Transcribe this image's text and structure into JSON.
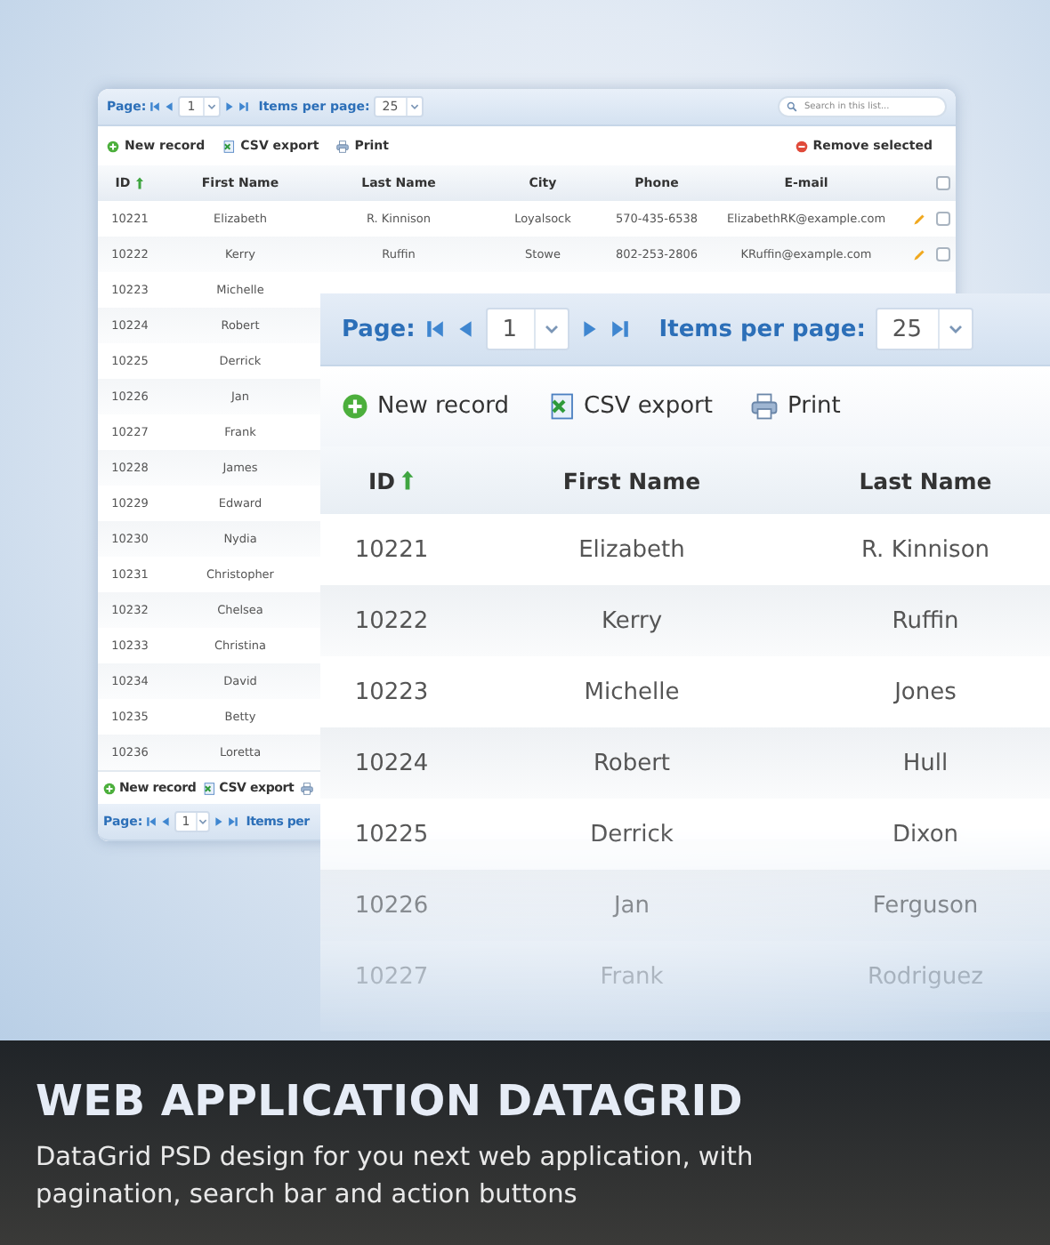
{
  "back_grid": {
    "pager": {
      "page_label": "Page:",
      "page": "1",
      "items_label": "Items per page:",
      "items_per_page": "25"
    },
    "search": {
      "placeholder": "Search in this list..."
    },
    "toolbar": [
      {
        "kind": "new",
        "label": "New record"
      },
      {
        "kind": "csv",
        "label": "CSV export"
      },
      {
        "kind": "print",
        "label": "Print"
      },
      {
        "kind": "remove",
        "label": "Remove selected"
      }
    ],
    "columns": [
      {
        "label": "ID",
        "sorted_ascending": true
      },
      {
        "label": "First Name",
        "sorted_ascending": false
      },
      {
        "label": "Last Name",
        "sorted_ascending": false
      },
      {
        "label": "City",
        "sorted_ascending": false
      },
      {
        "label": "Phone",
        "sorted_ascending": false
      },
      {
        "label": "E-mail",
        "sorted_ascending": false
      }
    ],
    "select_all": {
      "checked": false
    },
    "rows": [
      {
        "cells": [
          "10221",
          "Elizabeth",
          "R. Kinnison",
          "Loyalsock",
          "570-435-6538",
          "ElizabethRK@example.com"
        ],
        "checked": false
      },
      {
        "cells": [
          "10222",
          "Kerry",
          "Ruffin",
          "Stowe",
          "802-253-2806",
          "KRuffin@example.com"
        ],
        "checked": false
      },
      {
        "cells": [
          "10223",
          "Michelle"
        ]
      },
      {
        "cells": [
          "10224",
          "Robert"
        ]
      },
      {
        "cells": [
          "10225",
          "Derrick"
        ]
      },
      {
        "cells": [
          "10226",
          "Jan"
        ]
      },
      {
        "cells": [
          "10227",
          "Frank"
        ]
      },
      {
        "cells": [
          "10228",
          "James"
        ]
      },
      {
        "cells": [
          "10229",
          "Edward"
        ]
      },
      {
        "cells": [
          "10230",
          "Nydia"
        ]
      },
      {
        "cells": [
          "10231",
          "Christopher"
        ]
      },
      {
        "cells": [
          "10232",
          "Chelsea"
        ]
      },
      {
        "cells": [
          "10233",
          "Christina"
        ]
      },
      {
        "cells": [
          "10234",
          "David"
        ]
      },
      {
        "cells": [
          "10235",
          "Betty"
        ]
      },
      {
        "cells": [
          "10236",
          "Loretta"
        ]
      }
    ],
    "bottom_toolbar": [
      {
        "kind": "new",
        "label": "New record"
      },
      {
        "kind": "csv",
        "label": "CSV export"
      },
      {
        "kind": "print"
      }
    ],
    "bottom_pager": {
      "page_label": "Page:",
      "page": "1",
      "items_label": "Items per"
    }
  },
  "front_grid": {
    "pager": {
      "page_label": "Page:",
      "page": "1",
      "items_label": "Items per page:",
      "items_per_page": "25"
    },
    "toolbar": [
      {
        "kind": "new",
        "label": "New record"
      },
      {
        "kind": "csv",
        "label": "CSV export"
      },
      {
        "kind": "print",
        "label": "Print"
      }
    ],
    "columns": [
      {
        "label": "ID",
        "sorted_ascending": true
      },
      {
        "label": "First Name",
        "sorted_ascending": false
      },
      {
        "label": "Last Name",
        "sorted_ascending": false
      }
    ],
    "rows": [
      {
        "cells": [
          "10221",
          "Elizabeth",
          "R. Kinnison"
        ]
      },
      {
        "cells": [
          "10222",
          "Kerry",
          "Ruffin"
        ]
      },
      {
        "cells": [
          "10223",
          "Michelle",
          "Jones"
        ]
      },
      {
        "cells": [
          "10224",
          "Robert",
          "Hull"
        ]
      },
      {
        "cells": [
          "10225",
          "Derrick",
          "Dixon"
        ]
      },
      {
        "cells": [
          "10226",
          "Jan",
          "Ferguson"
        ]
      },
      {
        "cells": [
          "10227",
          "Frank",
          "Rodriguez"
        ]
      }
    ]
  },
  "banner": {
    "title": "WEB APPLICATION DATAGRID",
    "text": "DataGrid PSD design for you next web application, with pagination, search bar and action buttons"
  }
}
